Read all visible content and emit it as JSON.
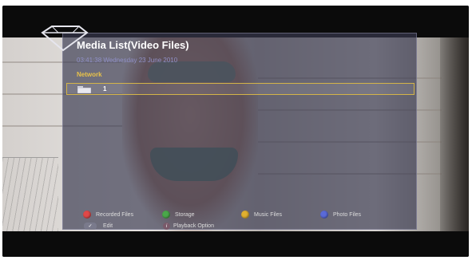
{
  "header": {
    "title": "Media List(Video Files)",
    "datetime": "03:41:38 Wednesday 23 June 2010"
  },
  "list": {
    "section_label": "Network",
    "items": [
      {
        "label": "1",
        "icon": "folder-icon"
      }
    ]
  },
  "footer": {
    "buttons": [
      {
        "label": "Recorded Files",
        "color": "#e04848",
        "icon": "red-button-icon"
      },
      {
        "label": "Storage",
        "color": "#4aa84a",
        "icon": "green-button-icon"
      },
      {
        "label": "Music Files",
        "color": "#e0b030",
        "icon": "yellow-button-icon"
      },
      {
        "label": "Photo Files",
        "color": "#5a6ad8",
        "icon": "blue-button-icon"
      }
    ],
    "edit_label": "Edit",
    "playback_option_label": "Playback Option"
  },
  "colors": {
    "panel": "#3a3a50",
    "title_text": "#ffffff",
    "datetime_text": "#9090c8",
    "section_text": "#e8c24a",
    "selection_border": "#d4b448"
  }
}
